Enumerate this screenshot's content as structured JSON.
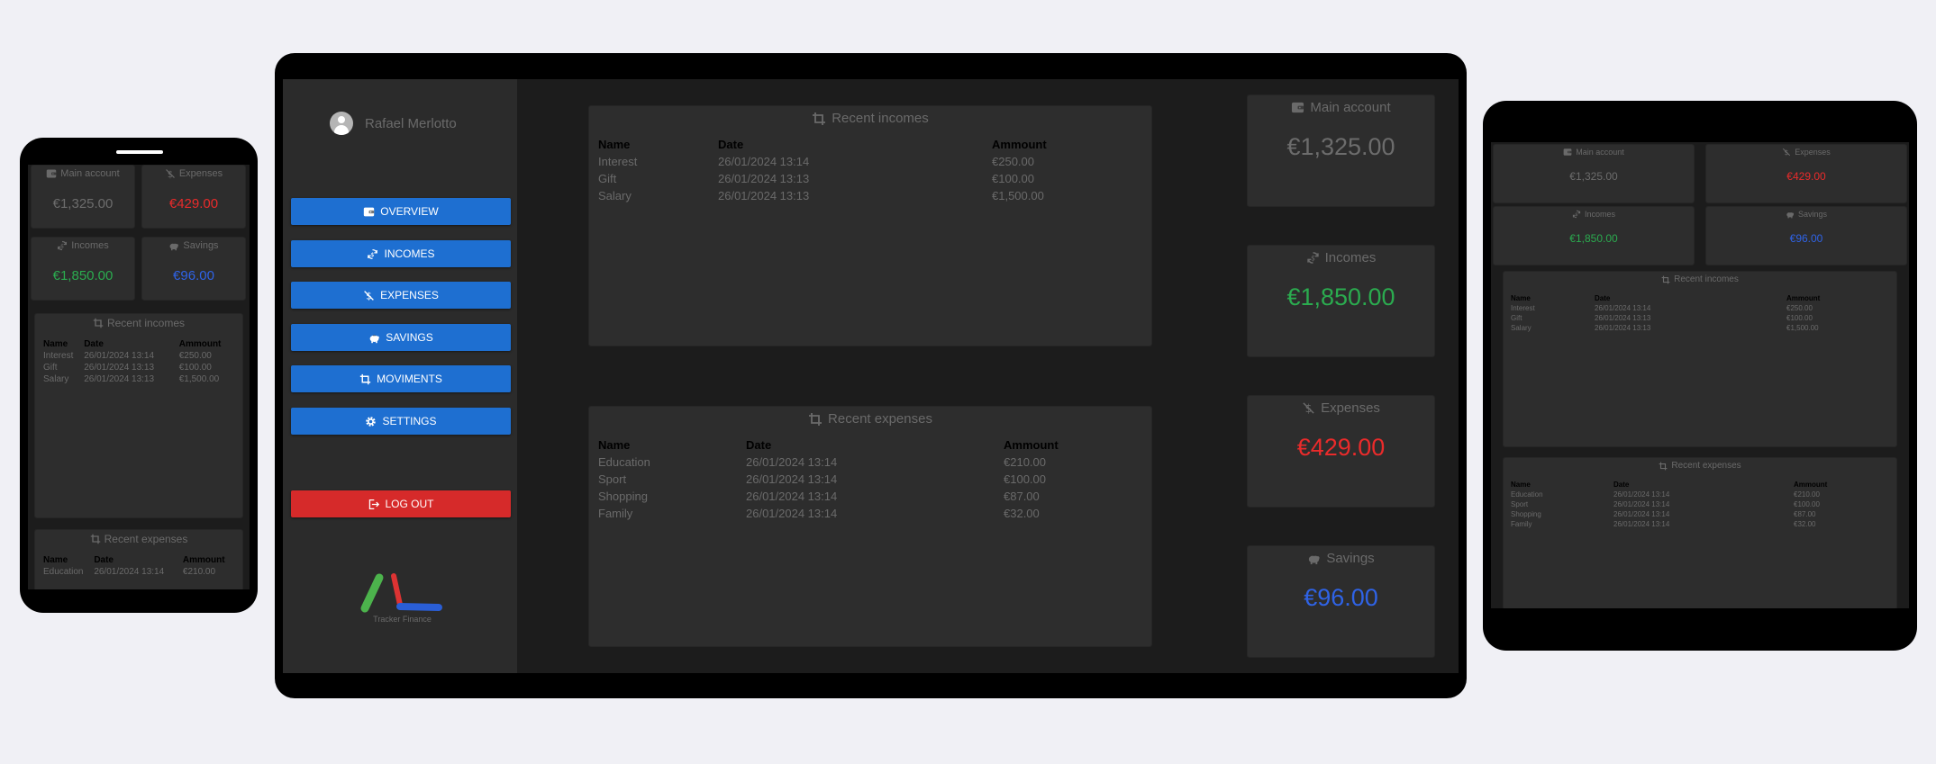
{
  "user": {
    "name": "Rafael Merlotto"
  },
  "nav": [
    {
      "label": "OVERVIEW",
      "icon": "wallet-icon"
    },
    {
      "label": "INCOMES",
      "icon": "refresh-dollar-icon"
    },
    {
      "label": "EXPENSES",
      "icon": "dollar-slash-icon"
    },
    {
      "label": "SAVINGS",
      "icon": "piggy-bank-icon"
    },
    {
      "label": "MOVIMENTS",
      "icon": "crop-icon"
    },
    {
      "label": "SETTINGS",
      "icon": "gear-icon"
    }
  ],
  "logout": {
    "label": "LOG OUT",
    "icon": "logout-icon"
  },
  "brand": {
    "name": "Tracker Finance"
  },
  "stats": {
    "main": {
      "label": "Main account",
      "value": "€1,325.00"
    },
    "incomes": {
      "label": "Incomes",
      "value": "€1,850.00"
    },
    "expenses": {
      "label": "Expenses",
      "value": "€429.00"
    },
    "savings": {
      "label": "Savings",
      "value": "€96.00"
    }
  },
  "colors": {
    "income": "#2bab4f",
    "expense": "#ea2b2b",
    "savings": "#2f63e6",
    "button": "#1e6fd1",
    "logout": "#d62a2a"
  },
  "recent_incomes": {
    "title": "Recent incomes",
    "headers": [
      "Name",
      "Date",
      "Ammount"
    ],
    "rows": [
      [
        "Interest",
        "26/01/2024 13:14",
        "€250.00"
      ],
      [
        "Gift",
        "26/01/2024 13:13",
        "€100.00"
      ],
      [
        "Salary",
        "26/01/2024 13:13",
        "€1,500.00"
      ]
    ]
  },
  "recent_expenses": {
    "title": "Recent expenses",
    "headers": [
      "Name",
      "Date",
      "Ammount"
    ],
    "rows": [
      [
        "Education",
        "26/01/2024 13:14",
        "€210.00"
      ],
      [
        "Sport",
        "26/01/2024 13:14",
        "€100.00"
      ],
      [
        "Shopping",
        "26/01/2024 13:14",
        "€87.00"
      ],
      [
        "Family",
        "26/01/2024 13:14",
        "€32.00"
      ]
    ]
  }
}
